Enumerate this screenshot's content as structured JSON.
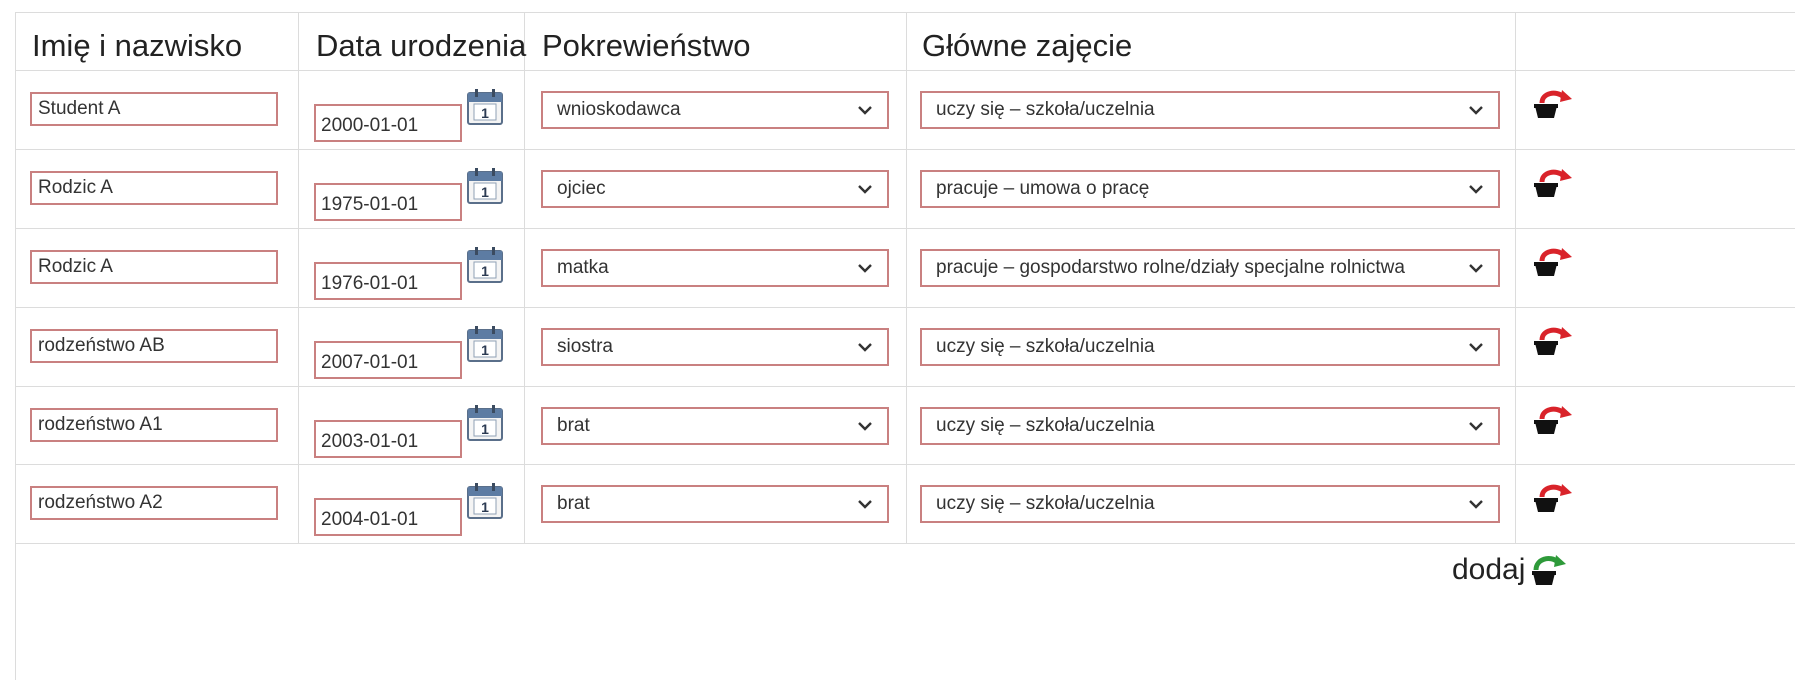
{
  "headers": {
    "name": "Imię i nazwisko",
    "dob": "Data urodzenia",
    "relation": "Pokrewieństwo",
    "occupation": "Główne zajęcie"
  },
  "rows": [
    {
      "name": "Student A",
      "dob": "2000-01-01",
      "relation": "wnioskodawca",
      "occupation": "uczy się – szkoła/uczelnia",
      "calendar_day": "1"
    },
    {
      "name": "Rodzic A",
      "dob": "1975-01-01",
      "relation": "ojciec",
      "occupation": "pracuje – umowa o pracę",
      "calendar_day": "1"
    },
    {
      "name": "Rodzic A",
      "dob": "1976-01-01",
      "relation": "matka",
      "occupation": "pracuje – gospodarstwo rolne/działy specjalne rolnictwa",
      "calendar_day": "1"
    },
    {
      "name": "rodzeństwo AB",
      "dob": "2007-01-01",
      "relation": "siostra",
      "occupation": "uczy się – szkoła/uczelnia",
      "calendar_day": "1"
    },
    {
      "name": "rodzeństwo A1",
      "dob": "2003-01-01",
      "relation": "brat",
      "occupation": "uczy się – szkoła/uczelnia",
      "calendar_day": "1"
    },
    {
      "name": "rodzeństwo A2",
      "dob": "2004-01-01",
      "relation": "brat",
      "occupation": "uczy się – szkoła/uczelnia",
      "calendar_day": "1"
    }
  ],
  "footer": {
    "add_label": "dodaj"
  },
  "icons": {
    "calendar": "calendar-icon",
    "delete": "remove-row-icon",
    "add": "add-row-icon",
    "dropdown": "chevron-down-icon"
  },
  "colors": {
    "input_border": "#c98080",
    "grid": "#dcdcdc",
    "delete_arrow": "#d9232a",
    "add_arrow": "#2e9a3a"
  }
}
